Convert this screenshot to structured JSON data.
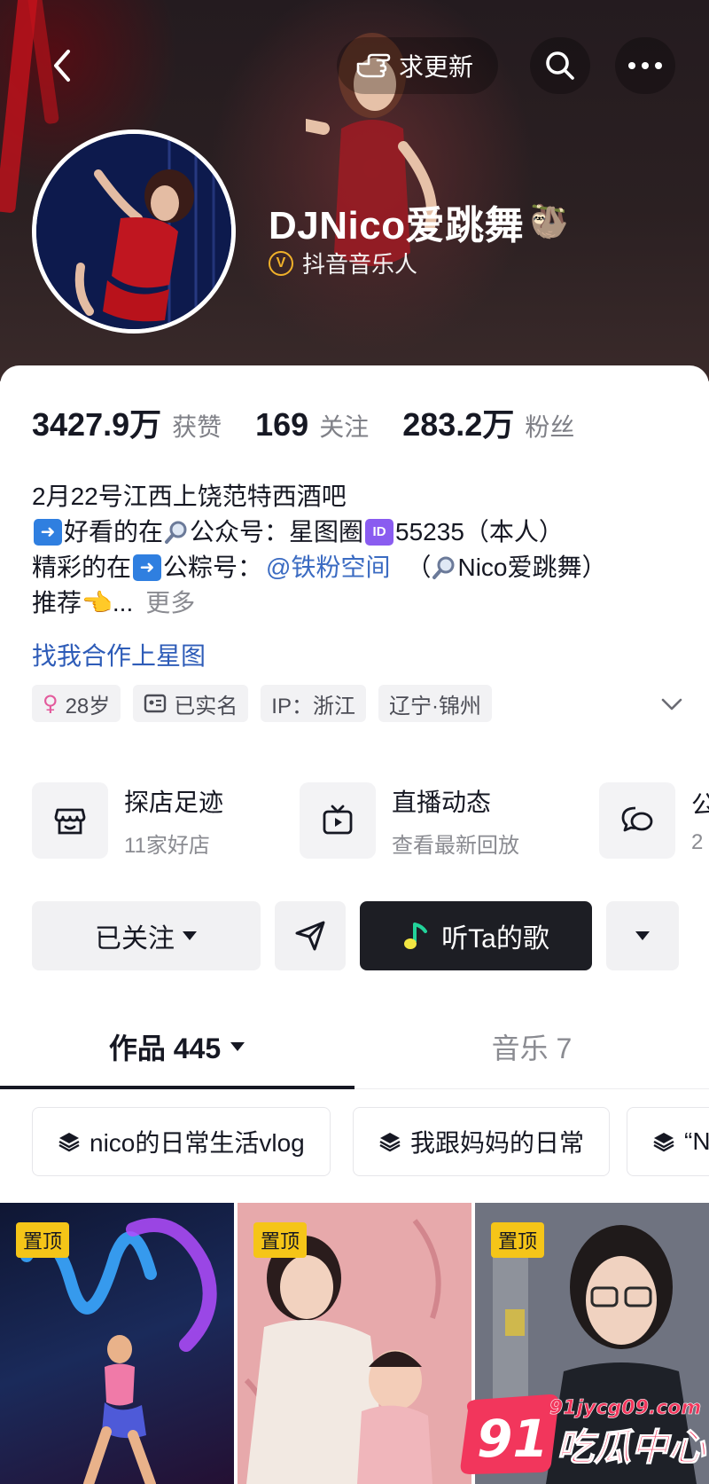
{
  "header": {
    "request_update_label": "求更新",
    "nickname": "DJNico爱跳舞",
    "nickname_emoji": "🦥",
    "verification_label": "抖音音乐人",
    "verification_icon_letter": "V"
  },
  "stats": [
    {
      "value": "3427.9万",
      "label": "获赞"
    },
    {
      "value": "169",
      "label": "关注"
    },
    {
      "value": "283.2万",
      "label": "粉丝"
    }
  ],
  "bio": {
    "line1": "2月22号江西上饶范特西酒吧",
    "line2_a": "好看的在",
    "line2_b": "公众号：星图圈",
    "line2_id_badge": "ID",
    "line2_c": "55235（本人）",
    "line3_a": "精彩的在",
    "line3_b": "公粽号：",
    "line3_mention": "@铁粉空间",
    "line3_c": "（",
    "line3_d": "Nico爱跳舞）",
    "line4_a": "推荐",
    "line4_emoji": "👈",
    "line4_ellipsis": "...",
    "more_label": "更多",
    "cooperation_link": "找我合作上星图"
  },
  "tags": [
    {
      "label": "28岁"
    },
    {
      "label": "已实名"
    },
    {
      "label": "IP：浙江"
    },
    {
      "label": "辽宁·锦州"
    }
  ],
  "entries": [
    {
      "title": "探店足迹",
      "subtitle": "11家好店"
    },
    {
      "title": "直播动态",
      "subtitle": "查看最新回放"
    },
    {
      "title": "公",
      "subtitle": "2"
    }
  ],
  "actions": {
    "follow_label": "已关注",
    "song_label": "听Ta的歌"
  },
  "tabs": [
    {
      "label": "作品 445"
    },
    {
      "label": "音乐 7"
    }
  ],
  "collections": [
    {
      "label": "nico的日常生活vlog"
    },
    {
      "label": "我跟妈妈的日常"
    },
    {
      "label": "“N"
    }
  ],
  "videos": [
    {
      "badge": "置顶"
    },
    {
      "badge": "置顶"
    },
    {
      "badge": "置顶"
    }
  ],
  "watermark": {
    "number": "91",
    "domain": "91jycg09.com",
    "slogan": "吃瓜中心"
  },
  "colors": {
    "accent_link": "#2e5cb8",
    "mention": "#3b6bc2",
    "pin_badge": "#f5c518",
    "dark_button": "#1d1e24",
    "verify_gold": "#f0b12a"
  }
}
